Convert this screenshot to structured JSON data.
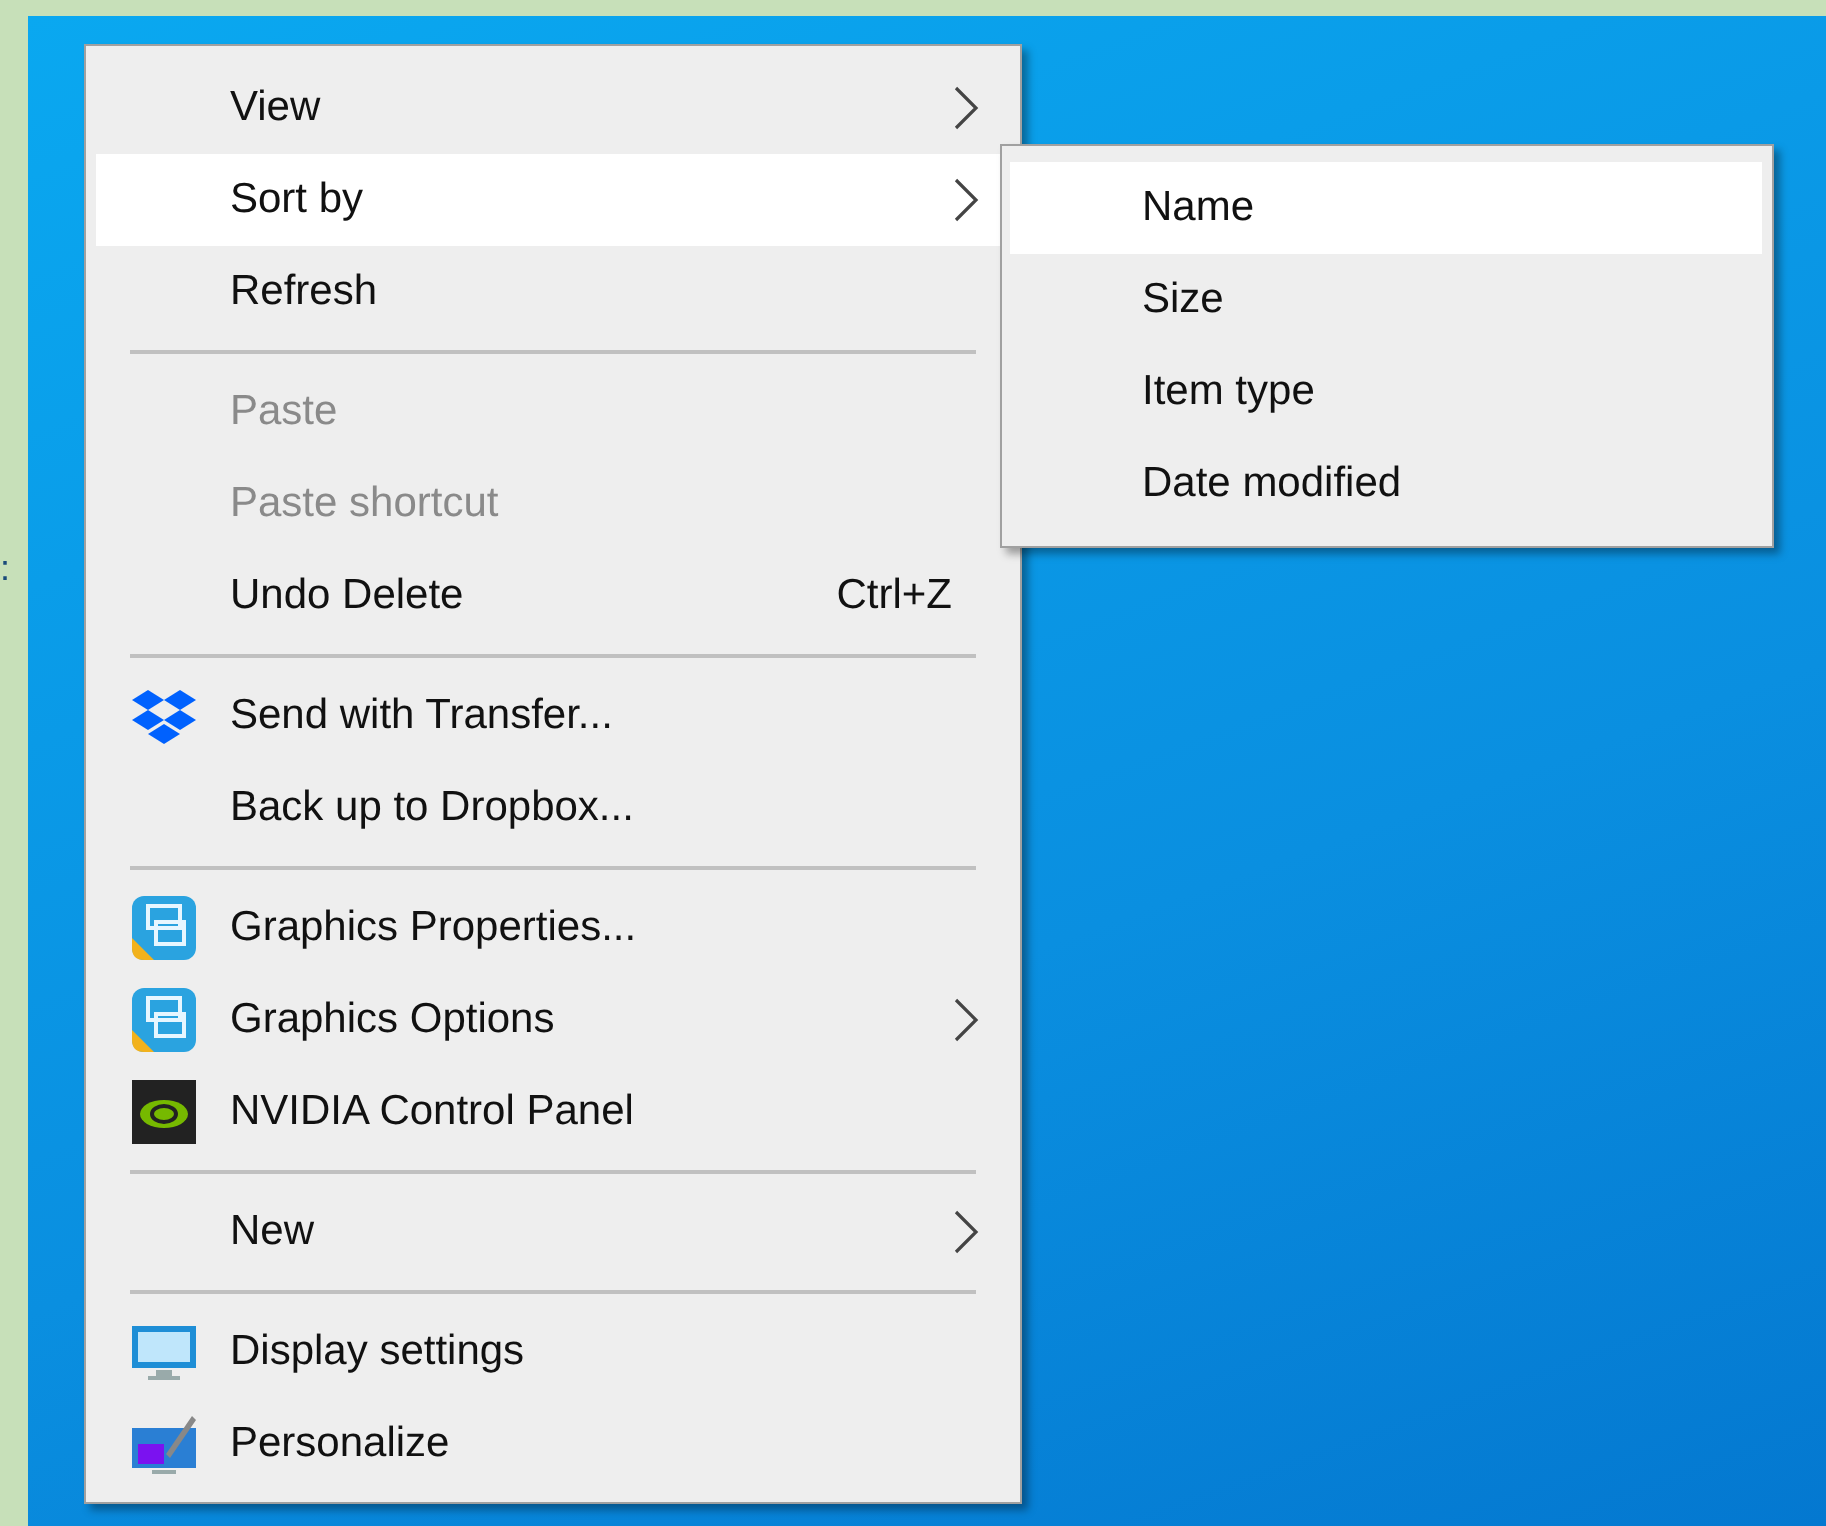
{
  "edge_text": ":",
  "context_menu": {
    "items": [
      {
        "kind": "item",
        "label": "View",
        "disabled": false,
        "selected": false,
        "has_submenu": true
      },
      {
        "kind": "item",
        "label": "Sort by",
        "disabled": false,
        "selected": true,
        "has_submenu": true
      },
      {
        "kind": "item",
        "label": "Refresh",
        "disabled": false,
        "selected": false,
        "has_submenu": false
      },
      {
        "kind": "separator"
      },
      {
        "kind": "item",
        "label": "Paste",
        "disabled": true,
        "selected": false,
        "has_submenu": false
      },
      {
        "kind": "item",
        "label": "Paste shortcut",
        "disabled": true,
        "selected": false,
        "has_submenu": false
      },
      {
        "kind": "item",
        "label": "Undo Delete",
        "shortcut": "Ctrl+Z",
        "disabled": false,
        "selected": false,
        "has_submenu": false
      },
      {
        "kind": "separator"
      },
      {
        "kind": "item",
        "label": "Send with Transfer...",
        "disabled": false,
        "selected": false,
        "has_submenu": false
      },
      {
        "kind": "item",
        "label": "Back up to Dropbox...",
        "disabled": false,
        "selected": false,
        "has_submenu": false
      },
      {
        "kind": "separator"
      },
      {
        "kind": "item",
        "label": "Graphics Properties...",
        "disabled": false,
        "selected": false,
        "has_submenu": false
      },
      {
        "kind": "item",
        "label": "Graphics Options",
        "disabled": false,
        "selected": false,
        "has_submenu": true
      },
      {
        "kind": "item",
        "label": "NVIDIA Control Panel",
        "disabled": false,
        "selected": false,
        "has_submenu": false
      },
      {
        "kind": "separator"
      },
      {
        "kind": "item",
        "label": "New",
        "disabled": false,
        "selected": false,
        "has_submenu": true
      },
      {
        "kind": "separator"
      },
      {
        "kind": "item",
        "label": "Display settings",
        "disabled": false,
        "selected": false,
        "has_submenu": false
      },
      {
        "kind": "item",
        "label": "Personalize",
        "disabled": false,
        "selected": false,
        "has_submenu": false
      }
    ]
  },
  "submenu": {
    "items": [
      {
        "label": "Name",
        "selected": true
      },
      {
        "label": "Size",
        "selected": false
      },
      {
        "label": "Item type",
        "selected": false
      },
      {
        "label": "Date modified",
        "selected": false
      }
    ]
  }
}
